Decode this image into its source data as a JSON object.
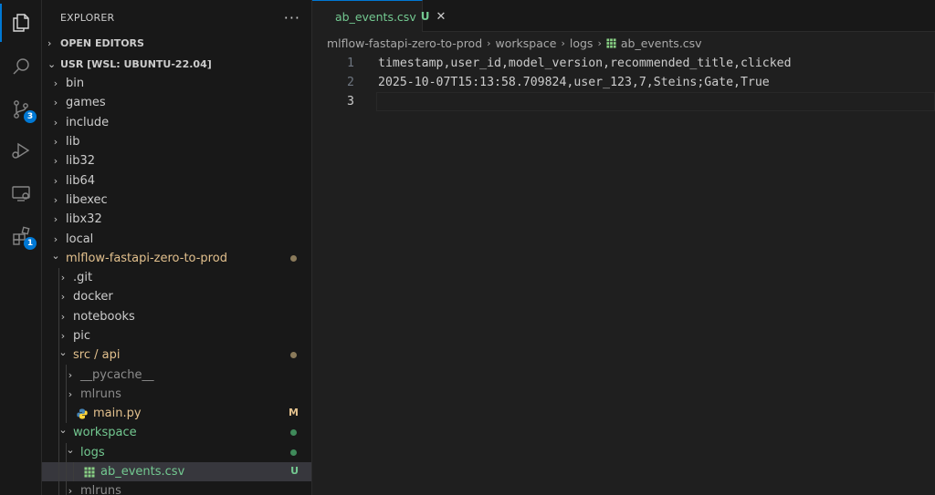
{
  "activity_bar": {
    "items": [
      {
        "name": "explorer",
        "active": true
      },
      {
        "name": "search"
      },
      {
        "name": "source-control",
        "badge": "3"
      },
      {
        "name": "run-debug"
      },
      {
        "name": "remote-explorer"
      },
      {
        "name": "extensions",
        "badge": "1"
      }
    ]
  },
  "sidebar": {
    "title": "EXPLORER",
    "more_actions": "···",
    "open_editors": "OPEN EDITORS",
    "workspace_title": "USR [WSL: UBUNTU-22.04]",
    "tree": [
      {
        "label": "bin",
        "depth": 0,
        "expanded": false
      },
      {
        "label": "games",
        "depth": 0,
        "expanded": false
      },
      {
        "label": "include",
        "depth": 0,
        "expanded": false
      },
      {
        "label": "lib",
        "depth": 0,
        "expanded": false
      },
      {
        "label": "lib32",
        "depth": 0,
        "expanded": false
      },
      {
        "label": "lib64",
        "depth": 0,
        "expanded": false
      },
      {
        "label": "libexec",
        "depth": 0,
        "expanded": false
      },
      {
        "label": "libx32",
        "depth": 0,
        "expanded": false
      },
      {
        "label": "local",
        "depth": 0,
        "expanded": false
      },
      {
        "label": "mlflow-fastapi-zero-to-prod",
        "depth": 0,
        "expanded": true,
        "state": "modified-dot"
      },
      {
        "label": ".git",
        "depth": 1,
        "expanded": false
      },
      {
        "label": "docker",
        "depth": 1,
        "expanded": false
      },
      {
        "label": "notebooks",
        "depth": 1,
        "expanded": false
      },
      {
        "label": "pic",
        "depth": 1,
        "expanded": false
      },
      {
        "label": "src / api",
        "depth": 1,
        "expanded": true,
        "state": "modified-dot"
      },
      {
        "label": "__pycache__",
        "depth": 2,
        "expanded": false,
        "dim": true
      },
      {
        "label": "mlruns",
        "depth": 2,
        "expanded": false,
        "dim": true
      },
      {
        "label": "main.py",
        "depth": 2,
        "file": "python",
        "state": "modified",
        "status": "M"
      },
      {
        "label": "workspace",
        "depth": 1,
        "expanded": true,
        "state": "untracked-dot"
      },
      {
        "label": "logs",
        "depth": 2,
        "expanded": true,
        "state": "untracked-dot"
      },
      {
        "label": "ab_events.csv",
        "depth": 3,
        "file": "csv",
        "state": "untracked",
        "status": "U",
        "selected": true
      },
      {
        "label": "mlruns",
        "depth": 2,
        "expanded": false,
        "dim": true
      }
    ]
  },
  "editor": {
    "tab": {
      "label": "ab_events.csv",
      "status": "U",
      "close": "✕"
    },
    "breadcrumb": [
      "mlflow-fastapi-zero-to-prod",
      "workspace",
      "logs",
      "ab_events.csv"
    ],
    "lines": [
      "timestamp,user_id,model_version,recommended_title,clicked",
      "2025-10-07T15:13:58.709824,user_123,7,Steins;Gate,True",
      ""
    ],
    "cursor_line": 3
  },
  "colors": {
    "accent": "#0078d4",
    "modified": "#e2c08d",
    "untracked": "#73c991",
    "csv_icon": "#89d185",
    "python_icon": "#4584b6"
  }
}
